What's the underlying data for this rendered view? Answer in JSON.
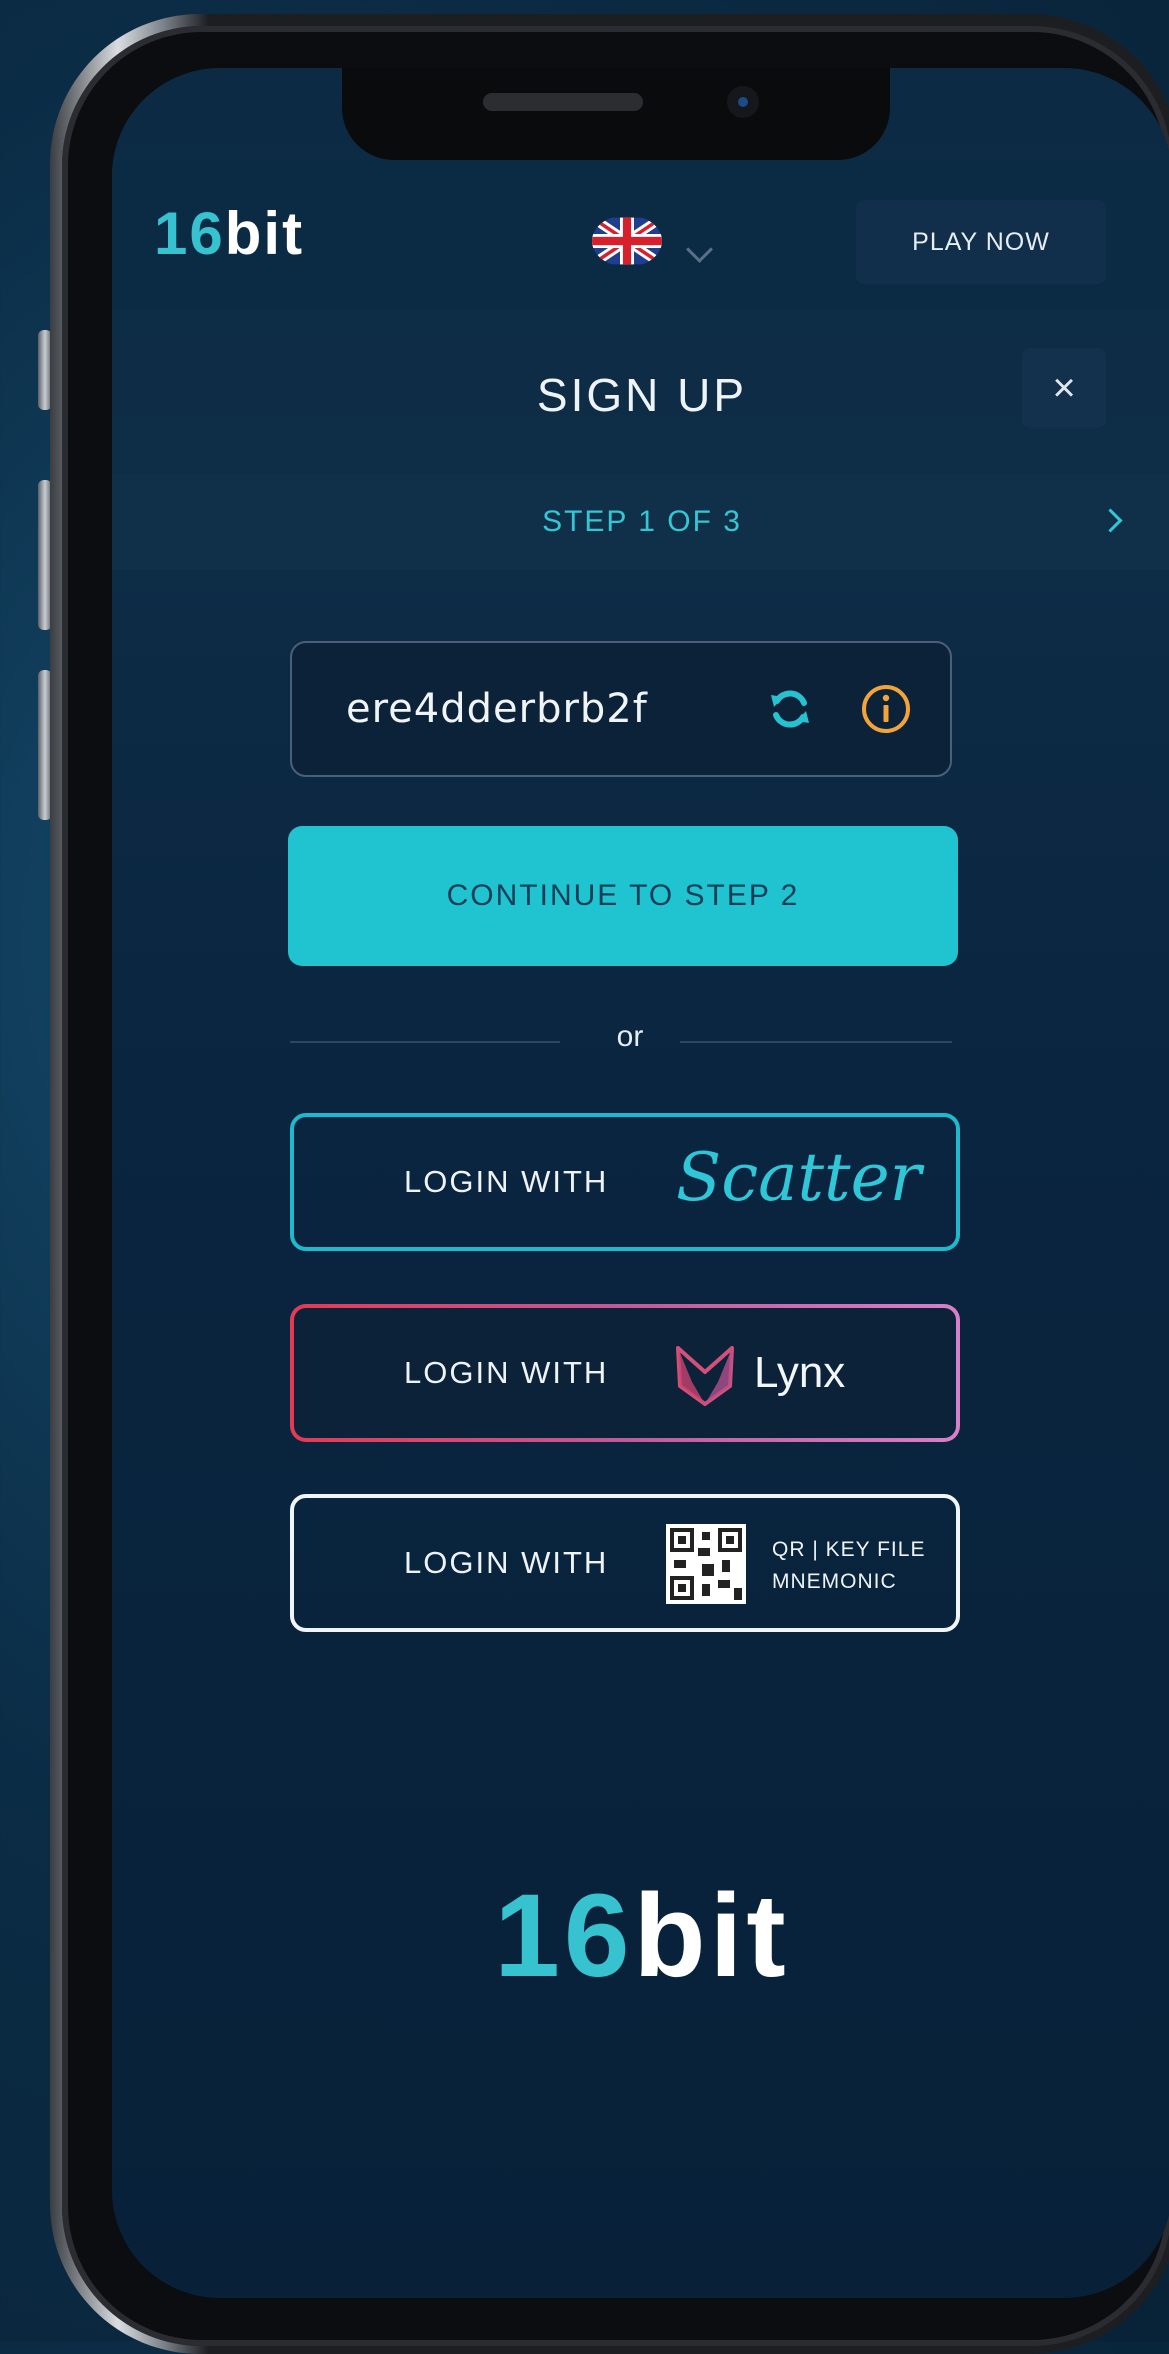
{
  "header": {
    "logo": {
      "part1": "16",
      "part2": "bit"
    },
    "language_flag": "uk-flag-icon",
    "play_now_label": "PLAY NOW"
  },
  "signup": {
    "title": "SIGN UP",
    "close_label": "×",
    "step_label": "STEP 1 OF 3"
  },
  "account_field": {
    "value": "ere4dderbrb2f",
    "refresh_icon": "refresh-icon",
    "info_icon": "info-icon"
  },
  "continue_label": "CONTINUE TO STEP 2",
  "or_label": "or",
  "logins": [
    {
      "label": "LOGIN WITH",
      "provider": "Scatter"
    },
    {
      "label": "LOGIN WITH",
      "provider": "Lynx"
    },
    {
      "label": "LOGIN WITH",
      "provider_line1": "QR | KEY FILE",
      "provider_line2": "MNEMONIC"
    }
  ],
  "footer_logo": {
    "part1": "16",
    "part2": "bit"
  },
  "colors": {
    "accent_cyan": "#20c3d0",
    "background": "#0b2b45",
    "scatter_border": "#1fb9ce",
    "lynx_gradient_start": "#e43a54",
    "info_orange": "#f2a43a"
  }
}
